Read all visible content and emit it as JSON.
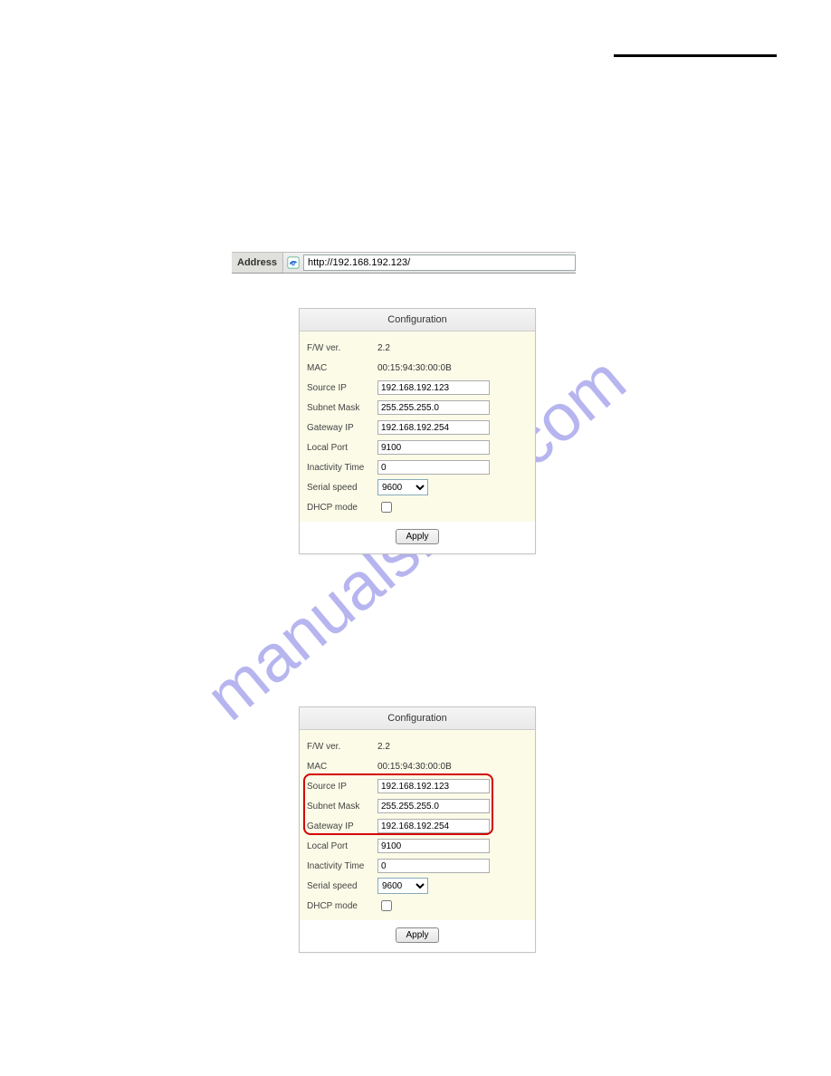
{
  "watermark": "manualshive.com",
  "address_bar": {
    "label": "Address",
    "url": "http://192.168.192.123/"
  },
  "panel": {
    "title": "Configuration",
    "apply_label": "Apply",
    "rows": {
      "fw_ver": {
        "label": "F/W ver.",
        "value": "2.2"
      },
      "mac": {
        "label": "MAC",
        "value": "00:15:94:30:00:0B"
      },
      "source_ip": {
        "label": "Source IP",
        "value": "192.168.192.123"
      },
      "subnet_mask": {
        "label": "Subnet Mask",
        "value": "255.255.255.0"
      },
      "gateway_ip": {
        "label": "Gateway IP",
        "value": "192.168.192.254"
      },
      "local_port": {
        "label": "Local Port",
        "value": "9100"
      },
      "inactivity_time": {
        "label": "Inactivity Time",
        "value": "0"
      },
      "serial_speed": {
        "label": "Serial speed",
        "value": "9600"
      },
      "dhcp_mode": {
        "label": "DHCP mode",
        "checked": false
      }
    }
  }
}
